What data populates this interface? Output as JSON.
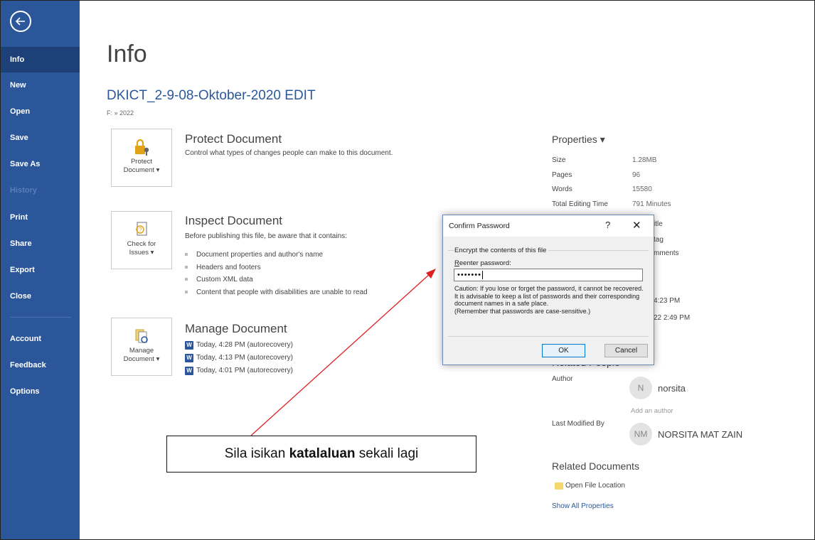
{
  "sidebar": {
    "items": [
      {
        "label": "Info"
      },
      {
        "label": "New"
      },
      {
        "label": "Open"
      },
      {
        "label": "Save"
      },
      {
        "label": "Save As"
      },
      {
        "label": "History"
      },
      {
        "label": "Print"
      },
      {
        "label": "Share"
      },
      {
        "label": "Export"
      },
      {
        "label": "Close"
      },
      {
        "label": "Account"
      },
      {
        "label": "Feedback"
      },
      {
        "label": "Options"
      }
    ],
    "active": "Info",
    "color": "#2b579a"
  },
  "main": {
    "page_title": "Info",
    "doc_title": "DKICT_2-9-08-Oktober-2020 EDIT",
    "doc_path": "F: » 2022",
    "protect": {
      "button_line1": "Protect",
      "button_line2": "Document ▾",
      "heading": "Protect Document",
      "desc": "Control what types of changes people can make to this document."
    },
    "inspect": {
      "button_line1": "Check for",
      "button_line2": "Issues ▾",
      "heading": "Inspect Document",
      "desc": "Before publishing this file, be aware that it contains:",
      "bullets": [
        "Document properties and author's name",
        "Headers and footers",
        "Custom XML data",
        "Content that people with disabilities are unable to read"
      ]
    },
    "manage": {
      "button_line1": "Manage",
      "button_line2": "Document ▾",
      "heading": "Manage Document",
      "versions": [
        "Today, 4:28 PM (autorecovery)",
        "Today, 4:13 PM (autorecovery)",
        "Today, 4:01 PM (autorecovery)"
      ]
    }
  },
  "properties": {
    "heading": "Properties ▾",
    "rows": [
      {
        "label": "Size",
        "value": "1.28MB"
      },
      {
        "label": "Pages",
        "value": "96"
      },
      {
        "label": "Words",
        "value": "15580"
      },
      {
        "label": "Total Editing Time",
        "value": "791 Minutes"
      }
    ],
    "partial_values": {
      "title": "itle",
      "tags": "tag",
      "comments": "mments",
      "modified": "4:23 PM",
      "created": "22 2:49 PM"
    },
    "related_people_heading": "Related People",
    "author_label": "Author",
    "author_initial": "N",
    "author_name": "norsita",
    "add_author": "Add an author",
    "last_modified_label": "Last Modified By",
    "last_modified_initials": "NM",
    "last_modified_name": "NORSITA MAT ZAIN",
    "related_docs_heading": "Related Documents",
    "open_location": "Open File Location",
    "show_all": "Show All Properties"
  },
  "dialog": {
    "title": "Confirm Password",
    "help_glyph": "?",
    "close_glyph": "✕",
    "group": "Encrypt the contents of this file",
    "label": "Reenter password:",
    "value": "•••••••",
    "caution": "Caution: If you lose or forget the password, it cannot be recovered. It is advisable to keep a list of passwords and their corresponding document names in a safe place.\n(Remember that passwords are case-sensitive.)",
    "ok": "OK",
    "cancel": "Cancel"
  },
  "annotation": {
    "text_before": "Sila isikan ",
    "text_bold": "katalaluan",
    "text_after": " sekali lagi",
    "arrow_color": "#e02020"
  }
}
